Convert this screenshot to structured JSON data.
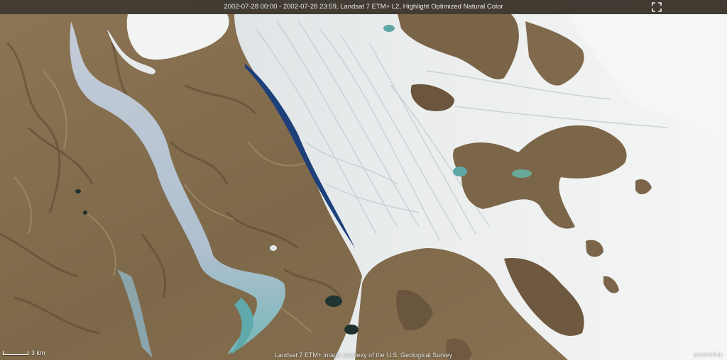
{
  "header": {
    "title": "2002-07-28 00:00 - 2002-07-28 23:59, Landsat 7 ETM+ L2, Highlight Optimized Natural Color",
    "fullscreen_icon": "fullscreen-icon"
  },
  "scale": {
    "label": "3 km"
  },
  "footer": {
    "attribution": "Landsat 7 ETM+ image courtesy of the U.S. Geological Survey",
    "logo_text": "sentinelhub"
  },
  "colors": {
    "terrain": "#8a7455",
    "terrain_dark": "#5e4b35",
    "ice": "#e9ecec",
    "ice_shadow": "#c9d0d4",
    "river_ice": "#b9c6d2",
    "meltwater": "#6fb3b2",
    "ice_front_shadow": "#1d3f7a",
    "header_bg": "#282828"
  }
}
